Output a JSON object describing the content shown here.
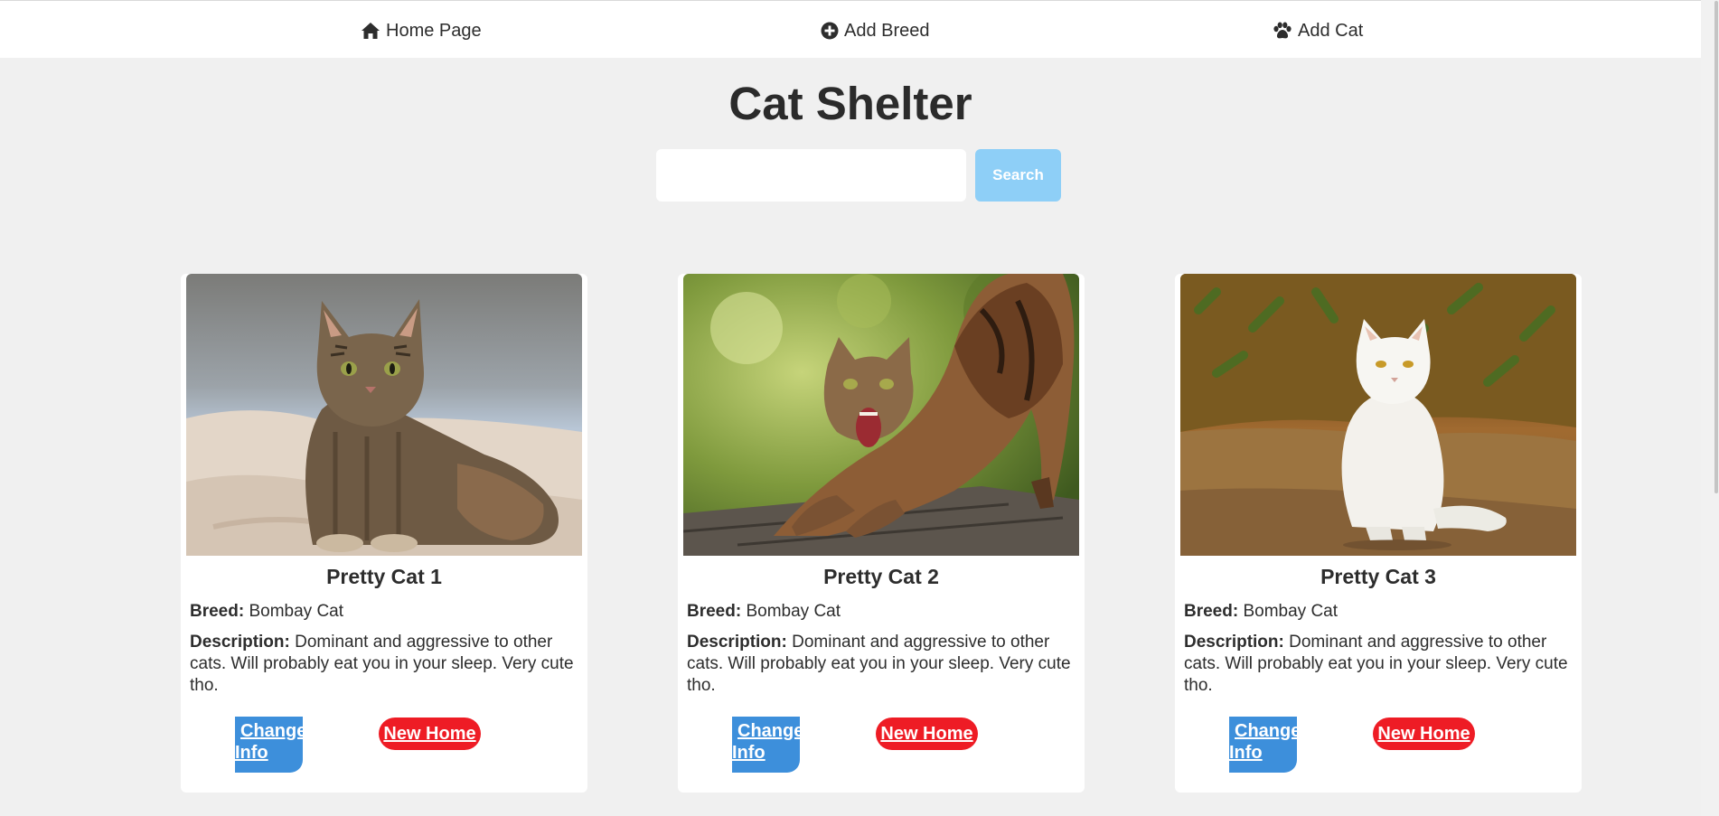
{
  "nav": {
    "home_label": "Home Page",
    "add_breed_label": "Add Breed",
    "add_cat_label": "Add Cat"
  },
  "header": {
    "title": "Cat Shelter"
  },
  "search": {
    "value": "",
    "placeholder": "",
    "button_label": "Search"
  },
  "cards": [
    {
      "name": "Pretty Cat 1",
      "breed_label": "Breed:",
      "breed": "Bombay Cat",
      "description_label": "Description:",
      "description": "Dominant and aggressive to other cats. Will probably eat you in your sleep. Very cute tho.",
      "change_info_line1": "Change",
      "change_info_line2": "Info",
      "new_home_label": "New Home",
      "photo_icon": "tabby-cat-lying-photo"
    },
    {
      "name": "Pretty Cat 2",
      "breed_label": "Breed:",
      "breed": "Bombay Cat",
      "description_label": "Description:",
      "description": "Dominant and aggressive to other cats. Will probably eat you in your sleep. Very cute tho.",
      "change_info_line1": "Change",
      "change_info_line2": "Info",
      "new_home_label": "New Home",
      "photo_icon": "tabby-cat-stretching-photo"
    },
    {
      "name": "Pretty Cat 3",
      "breed_label": "Breed:",
      "breed": "Bombay Cat",
      "description_label": "Description:",
      "description": "Dominant and aggressive to other cats. Will probably eat you in your sleep. Very cute tho.",
      "change_info_line1": "Change",
      "change_info_line2": "Info",
      "new_home_label": "New Home",
      "photo_icon": "white-cat-sitting-photo"
    }
  ],
  "colors": {
    "page_background": "#f0f0f0",
    "search_button": "#8ecff7",
    "change_info_button": "#3d8fdb",
    "new_home_button": "#ee1c25"
  }
}
